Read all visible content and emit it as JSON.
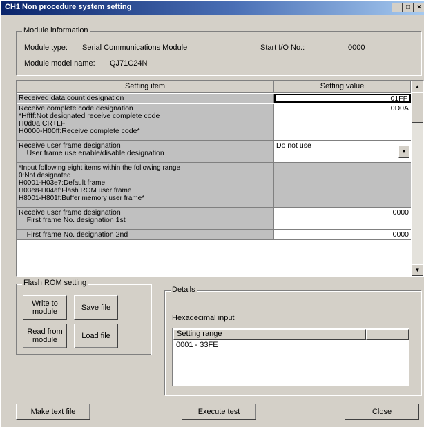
{
  "window": {
    "title": "CH1 Non procedure system setting",
    "controls": [
      "_",
      "□",
      "×"
    ]
  },
  "module_info": {
    "legend": "Module information",
    "type_label": "Module type:",
    "type_value": "Serial Communications Module",
    "start_io_label": "Start I/O No.:",
    "start_io_value": "0000",
    "model_label": "Module model name:",
    "model_value": "QJ71C24N"
  },
  "grid": {
    "headers": [
      "Setting item",
      "Setting value"
    ],
    "rows": [
      {
        "item": [
          "Received data count designation"
        ],
        "value": "01FF"
      },
      {
        "item": [
          "Receive complete code designation",
          "*Hffff:Not designated receive complete code",
          " H0d0a:CR+LF",
          " H0000-H00ff:Receive complete code*"
        ],
        "value": "0D0A"
      },
      {
        "item": [
          "Receive user frame designation",
          "    User frame use enable/disable designation"
        ],
        "value": "Do not use"
      },
      {
        "item": [
          "*Input following eight items within the following range",
          " 0:Not designated",
          " H0001-H03e7:Default frame",
          " H03e8-H04af:Flash ROM user frame",
          " H8001-H801f:Buffer memory user frame*"
        ],
        "value": ""
      },
      {
        "item": [
          "Receive user frame designation",
          "    First frame No. designation 1st"
        ],
        "value": "0000"
      },
      {
        "item": [
          "    First frame No. designation 2nd"
        ],
        "value": "0000"
      }
    ]
  },
  "flash_rom": {
    "legend": "Flash ROM setting",
    "write_label": "Write to\nmodule",
    "save_label": "Save file",
    "read_label": "Read from\nmodule",
    "load_label": "Load file"
  },
  "details": {
    "legend": "Details",
    "input_type": "Hexadecimal input",
    "list_header": "Setting range",
    "list_value": "0001 - 33FE"
  },
  "footer": {
    "make_text_label": "Make text file",
    "execute_label": "Execute test",
    "execute_accel": "t",
    "close_label": "Close"
  }
}
